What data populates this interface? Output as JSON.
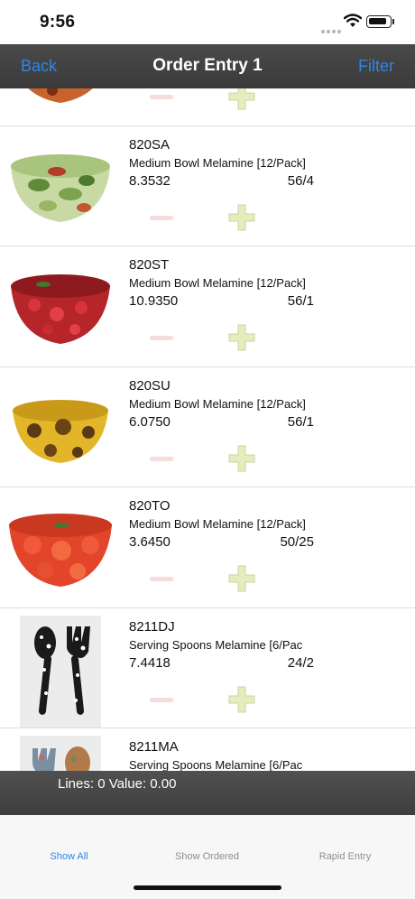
{
  "status_bar": {
    "time": "9:56"
  },
  "nav": {
    "back_label": "Back",
    "title": "Order Entry 1",
    "filter_label": "Filter"
  },
  "items": [
    {
      "code": "",
      "description": "",
      "price": "",
      "pack": "",
      "image": "pepper-bowl"
    },
    {
      "code": "820SA",
      "description": "Medium Bowl Melamine [12/Pack]",
      "price": "8.3532",
      "pack": "56/4",
      "image": "salad-bowl"
    },
    {
      "code": "820ST",
      "description": "Medium Bowl Melamine [12/Pack]",
      "price": "10.9350",
      "pack": "56/1",
      "image": "strawberry-bowl"
    },
    {
      "code": "820SU",
      "description": "Medium Bowl Melamine [12/Pack]",
      "price": "6.0750",
      "pack": "56/1",
      "image": "sunflower-bowl"
    },
    {
      "code": "820TO",
      "description": "Medium Bowl Melamine [12/Pack]",
      "price": "3.6450",
      "pack": "50/25",
      "image": "tomato-bowl"
    },
    {
      "code": "8211DJ",
      "description": "Serving Spoons Melamine [6/Pac",
      "price": "7.4418",
      "pack": "24/2",
      "image": "polka-dot-spoons"
    },
    {
      "code": "8211MA",
      "description": "Serving Spoons Melamine [6/Pac",
      "price": "",
      "pack": "",
      "image": "pattern-spoons"
    }
  ],
  "summary": {
    "text": "Lines: 0 Value: 0.00"
  },
  "tabs": {
    "show_all": "Show All",
    "show_ordered": "Show Ordered",
    "rapid_entry": "Rapid Entry"
  },
  "colors": {
    "accent": "#2f86e8",
    "bar": "#424242",
    "plus": "#e3edbd",
    "minus": "#f7dcdc"
  }
}
